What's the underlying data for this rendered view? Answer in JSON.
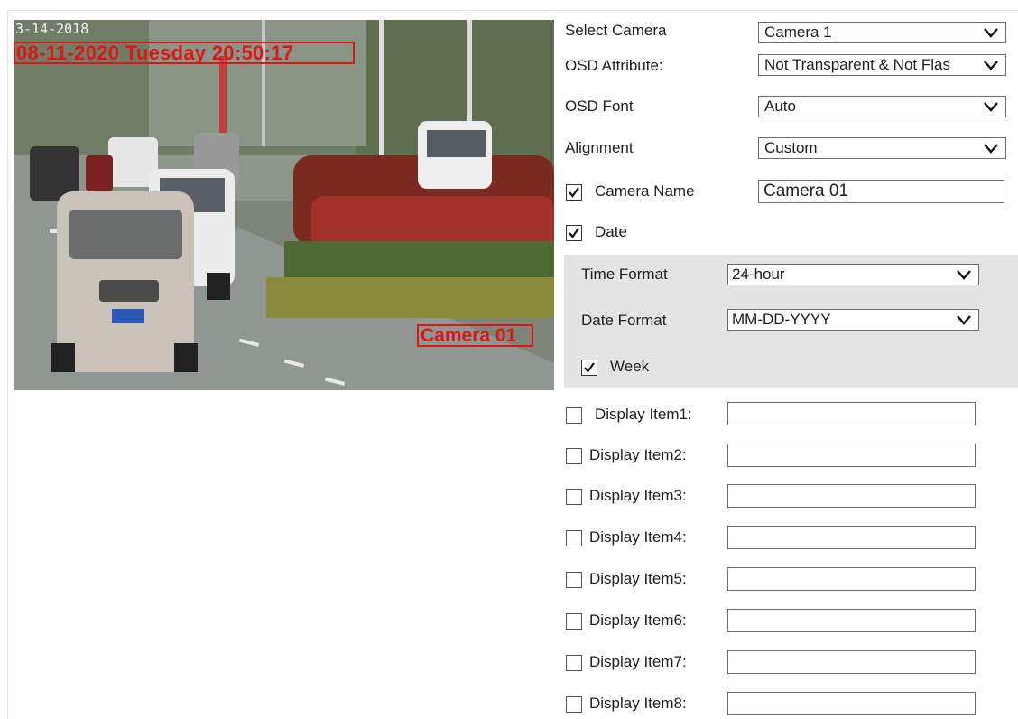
{
  "preview": {
    "osd_datetime": "08-11-2020 Tuesday 20:50:17",
    "osd_camera_name": "Camera 01",
    "osd_colors": {
      "box": "#e01515"
    }
  },
  "settings": {
    "select_camera": {
      "label": "Select Camera",
      "value": "Camera 1"
    },
    "osd_attribute": {
      "label": "OSD Attribute:",
      "value": "Not Transparent & Not Flas"
    },
    "osd_font": {
      "label": "OSD Font",
      "value": "Auto"
    },
    "alignment": {
      "label": "Alignment",
      "value": "Custom"
    },
    "camera_name": {
      "label": "Camera Name",
      "checked": true,
      "value": "Camera 01"
    },
    "date": {
      "label": "Date",
      "checked": true
    },
    "time_format": {
      "label": "Time Format",
      "value": "24-hour"
    },
    "date_format": {
      "label": "Date Format",
      "value": "MM-DD-YYYY"
    },
    "week": {
      "label": "Week",
      "checked": true
    },
    "display_items": [
      {
        "label": "Display Item1:",
        "checked": false,
        "value": ""
      },
      {
        "label": "Display Item2:",
        "checked": false,
        "value": ""
      },
      {
        "label": "Display Item3:",
        "checked": false,
        "value": ""
      },
      {
        "label": "Display Item4:",
        "checked": false,
        "value": ""
      },
      {
        "label": "Display Item5:",
        "checked": false,
        "value": ""
      },
      {
        "label": "Display Item6:",
        "checked": false,
        "value": ""
      },
      {
        "label": "Display Item7:",
        "checked": false,
        "value": ""
      },
      {
        "label": "Display Item8:",
        "checked": false,
        "value": ""
      }
    ]
  }
}
